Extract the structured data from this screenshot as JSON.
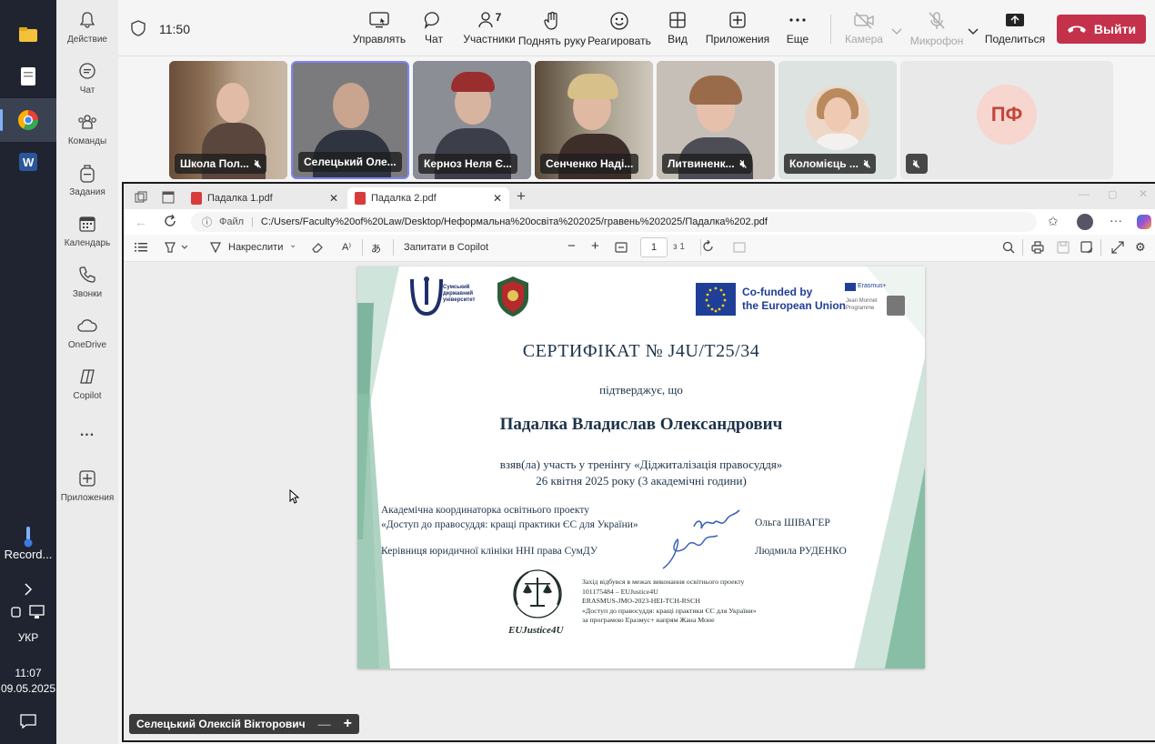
{
  "taskbar": {
    "record_label": "Record...",
    "language": "УКР",
    "time": "11:07",
    "date": "09.05.2025"
  },
  "rail": {
    "items": [
      {
        "label": "Действие",
        "icon": "bell-icon"
      },
      {
        "label": "Чат",
        "icon": "chat-icon"
      },
      {
        "label": "Команды",
        "icon": "teams-icon"
      },
      {
        "label": "Задания",
        "icon": "backpack-icon"
      },
      {
        "label": "Календарь",
        "icon": "calendar-icon"
      },
      {
        "label": "Звонки",
        "icon": "phone-icon"
      },
      {
        "label": "OneDrive",
        "icon": "cloud-icon"
      },
      {
        "label": "Copilot",
        "icon": "copilot-icon"
      },
      {
        "label": "...",
        "icon": "more-icon"
      },
      {
        "label": "Приложения",
        "icon": "plus-icon"
      }
    ]
  },
  "meeting": {
    "timer": "11:50",
    "controls": [
      {
        "label": "Управлять"
      },
      {
        "label": "Чат"
      },
      {
        "label": "Участники",
        "badge": "7"
      },
      {
        "label": "Поднять руку"
      },
      {
        "label": "Реагировать"
      },
      {
        "label": "Вид"
      },
      {
        "label": "Приложения"
      },
      {
        "label": "Еще"
      },
      {
        "label": "Камера"
      },
      {
        "label": "Микрофон"
      },
      {
        "label": "Поделиться"
      }
    ],
    "leave_label": "Выйти",
    "participants": [
      {
        "name": "Школа Пол..."
      },
      {
        "name": "Селецький Оле..."
      },
      {
        "name": "Керноз Неля Є..."
      },
      {
        "name": "Сенченко Наді..."
      },
      {
        "name": "Литвиненк..."
      },
      {
        "name": "Коломієць ..."
      },
      {
        "initials": "ПФ"
      }
    ],
    "presenter_label": "Селецький Олексій Вікторович"
  },
  "browser": {
    "tabs": [
      {
        "label": "Падалка 1.pdf"
      },
      {
        "label": "Падалка 2.pdf"
      }
    ],
    "file_label": "Файл",
    "url": "C:/Users/Faculty%20of%20Law/Desktop/Неформальна%20освіта%202025/гравень%202025/Падалка%202.pdf",
    "pdf_toolbar": {
      "draw_label": "Накреслити",
      "copilot_label": "Запитати в Copilot",
      "page_value": "1",
      "page_total": "з 1"
    }
  },
  "certificate": {
    "university_logo_text": "Сумський державний університет",
    "eu_text_line1": "Co-funded by",
    "eu_text_line2": "the European Union",
    "erasmus_text": "Erasmus+",
    "jean_monnet_text": "Jean Monnet Programme",
    "title": "СЕРТИФІКАТ  № J4U/T25/34",
    "confirms": "підтверджує, що",
    "recipient": "Падалка Владислав Олександрович",
    "line1": "взяв(ла) участь у тренінгу «Діджиталізація правосуддя»",
    "line2": "26 квітня 2025 року  (3 академічні години)",
    "coordinator_role1": "Академічна координаторка освітнього проекту",
    "coordinator_role2": "«Доступ до правосуддя: кращі практики ЄС для України»",
    "coordinator_name": "Ольга ШІВАГЕР",
    "head_role": "Керівниця юридичної клініки ННІ права СумДУ",
    "head_name": "Людмила РУДЕНКО",
    "emblem_text": "EUJustice4U",
    "note": [
      "Захід відбувся в межах виконання освітнього проекту",
      "101175484 – EUJustice4U",
      "ERASMUS-JMO-2023-HEI-TCH-RSCH",
      "«Доступ до правосуддя: кращі практики ЄС для України»",
      "за програмою Еразмус+ напрям Жана Моне"
    ]
  },
  "colors": {
    "leave": "#c4314b",
    "cert_text": "#1d3349",
    "cert_green": "#4e9c7d"
  }
}
